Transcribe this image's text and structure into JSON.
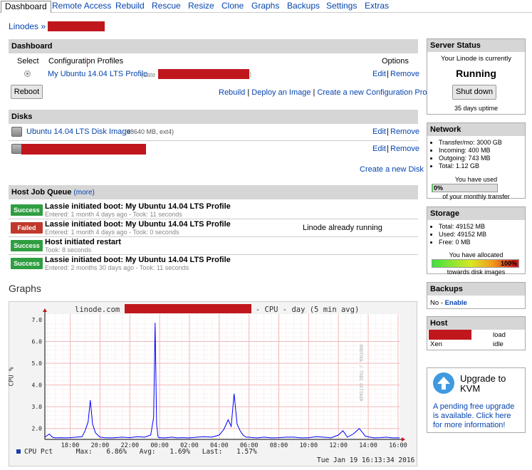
{
  "tabs": [
    {
      "label": "Dashboard",
      "active": true
    },
    {
      "label": "Remote Access"
    },
    {
      "label": "Rebuild"
    },
    {
      "label": "Rescue"
    },
    {
      "label": "Resize"
    },
    {
      "label": "Clone"
    },
    {
      "label": "Graphs"
    },
    {
      "label": "Backups"
    },
    {
      "label": "Settings"
    },
    {
      "label": "Extras"
    }
  ],
  "breadcrumb": {
    "root": "Linodes »"
  },
  "dashboard": {
    "title": "Dashboard",
    "col_select": "Select",
    "col_profiles": "Configuration Profiles",
    "col_options": "Options",
    "profile_name": "My Ubuntu 14.04 LTS Profile",
    "profile_suffix": "(Late",
    "profile_suffix_end": ")",
    "edit": "Edit",
    "sep": "|",
    "remove": "Remove",
    "reboot": "Reboot",
    "rebuild": "Rebuild",
    "deploy": "Deploy an Image",
    "create_profile": "Create a new Configuration Profile"
  },
  "disks": {
    "title": "Disks",
    "disk1_name": "Ubuntu 14.04 LTS Disk Image",
    "disk1_info": "(48640 MB, ext4)",
    "edit": "Edit",
    "remove": "Remove",
    "create": "Create a new Disk"
  },
  "jobs": {
    "title": "Host Job Queue",
    "more": "(more)",
    "items": [
      {
        "status": "Success",
        "title": "Lassie initiated boot: My Ubuntu 14.04 LTS Profile",
        "sub": "Entered: 1 month 4 days ago - Took: 11 seconds",
        "note": ""
      },
      {
        "status": "Failed",
        "title": "Lassie initiated boot: My Ubuntu 14.04 LTS Profile",
        "sub": "Entered: 1 month 4 days ago - Took: 0 seconds",
        "note": "Linode already running"
      },
      {
        "status": "Success",
        "title": "Host initiated restart",
        "sub": "Took: 8 seconds",
        "note": ""
      },
      {
        "status": "Success",
        "title": "Lassie initiated boot: My Ubuntu 14.04 LTS Profile",
        "sub": "Entered: 2 months 30 days ago - Took: 11 seconds",
        "note": ""
      }
    ]
  },
  "graphs": {
    "title": "Graphs"
  },
  "server_status": {
    "title": "Server Status",
    "line1": "Your Linode is currently",
    "state": "Running",
    "button": "Shut down",
    "uptime": "35 days uptime"
  },
  "network": {
    "title": "Network",
    "items": [
      "Transfer/mo: 3000 GB",
      "Incoming: 400 MB",
      "Outgoing: 743 MB",
      "Total: 1.12 GB"
    ],
    "used_label": "You have used",
    "pct": "0%",
    "pct_value": 0,
    "footer": "of your monthly transfer"
  },
  "storage": {
    "title": "Storage",
    "items": [
      "Total: 49152 MB",
      "Used: 49152 MB",
      "Free: 0 MB"
    ],
    "alloc_label": "You have allocated",
    "pct": "100%",
    "pct_value": 100,
    "footer": "towards disk images"
  },
  "backups": {
    "title": "Backups",
    "text": "No -",
    "link": "Enable"
  },
  "host": {
    "title": "Host",
    "load": "load",
    "xen": "Xen",
    "idle": "idle"
  },
  "upgrade": {
    "title": "Upgrade to KVM",
    "body": "A pending free upgrade is available. Click here for more information!"
  },
  "colors": {
    "success": "#2f9e41",
    "failed": "#c0392b",
    "redaction": "#c0171d",
    "cpu_line": "#0000ff"
  },
  "chart_data": {
    "type": "line",
    "title_prefix": "linode.com",
    "title_suffix": "- CPU - day (5 min avg)",
    "ylabel": "CPU %",
    "ylim": [
      1.5,
      7.0
    ],
    "yticks": [
      2.0,
      3.0,
      4.0,
      5.0,
      6.0,
      7.0
    ],
    "xticks": [
      "18:00",
      "20:00",
      "22:00",
      "00:00",
      "02:00",
      "04:00",
      "06:00",
      "08:00",
      "10:00",
      "12:00",
      "14:00",
      "16:00"
    ],
    "x_hours_start": 16.3,
    "x_hours_end": 40.1,
    "right_label": "RRDTOOL / TOBI OETIKER",
    "legend": "CPU Pct",
    "max_label": "Max:",
    "max": "6.86%",
    "avg_label": "Avg:",
    "avg": "1.69%",
    "last_label": "Last:",
    "last": "1.57%",
    "timestamp": "Tue Jan 19 16:13:34 2016",
    "series": [
      {
        "name": "CPU Pct",
        "x": [
          16.3,
          16.6,
          16.8,
          17.0,
          17.3,
          17.6,
          18.0,
          18.4,
          18.8,
          19.0,
          19.2,
          19.35,
          19.5,
          19.7,
          20.0,
          20.3,
          20.7,
          21.0,
          21.5,
          22.0,
          22.5,
          23.0,
          23.4,
          23.6,
          23.7,
          23.8,
          23.9,
          24.0,
          24.3,
          24.5,
          24.8,
          25.2,
          25.5,
          26.0,
          26.5,
          27.0,
          27.5,
          28.0,
          28.3,
          28.6,
          28.8,
          29.0,
          29.2,
          29.4,
          29.6,
          29.8,
          30.0,
          30.3,
          30.6,
          31.0,
          31.5,
          32.0,
          32.5,
          33.0,
          33.5,
          34.0,
          34.5,
          35.0,
          35.5,
          36.0,
          36.3,
          36.6,
          37.0,
          37.4,
          37.8,
          38.1,
          38.4,
          38.8,
          39.2,
          39.6,
          40.1
        ],
        "y": [
          1.6,
          1.75,
          1.6,
          1.57,
          1.58,
          1.57,
          1.58,
          1.6,
          1.62,
          1.9,
          2.3,
          3.3,
          2.2,
          1.8,
          1.6,
          1.58,
          1.57,
          1.58,
          1.6,
          1.58,
          1.62,
          1.6,
          1.7,
          2.5,
          6.86,
          2.2,
          1.6,
          1.58,
          1.57,
          1.58,
          1.6,
          1.57,
          1.58,
          1.57,
          1.6,
          1.62,
          1.6,
          1.7,
          1.95,
          2.4,
          2.1,
          3.6,
          2.2,
          1.9,
          1.7,
          1.6,
          1.6,
          1.58,
          1.57,
          1.6,
          1.57,
          1.58,
          1.6,
          1.6,
          1.57,
          1.58,
          1.62,
          1.6,
          1.57,
          1.7,
          1.9,
          1.6,
          1.75,
          2.0,
          1.65,
          1.6,
          1.57,
          1.58,
          1.6,
          1.57,
          1.57
        ]
      }
    ]
  }
}
